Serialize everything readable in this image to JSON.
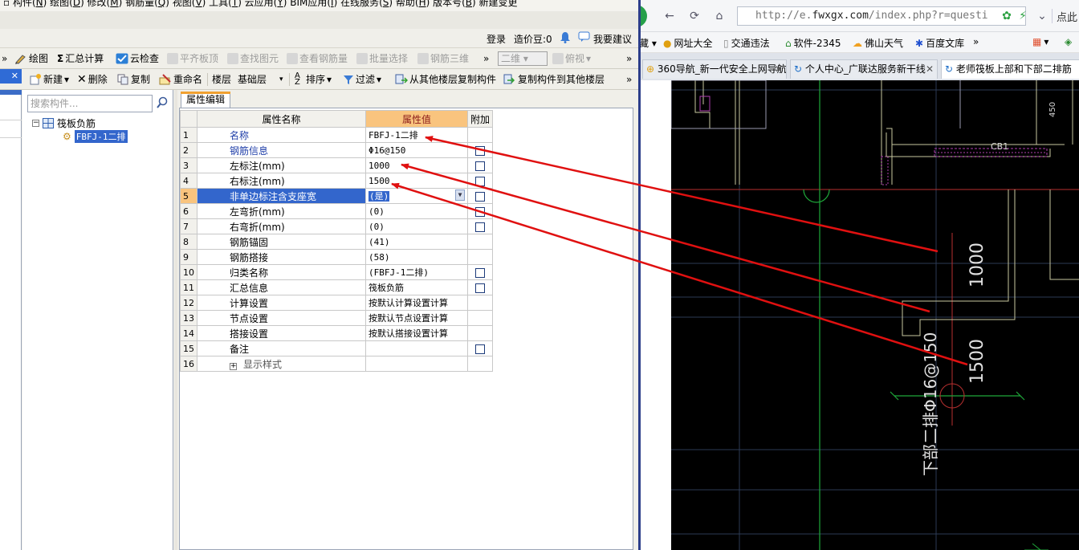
{
  "app": {
    "login": "登录",
    "price_bean": "造价豆:0",
    "suggest": "我要建议"
  },
  "toolbar1": {
    "draw": "绘图",
    "summary": "汇总计算",
    "cloud_check": "云检查",
    "align_top": "平齐板顶",
    "find_element": "查找图元",
    "view_rebar": "查看钢筋量",
    "batch_select": "批量选择",
    "rebar_3d": "钢筋三维",
    "view_mode": "二维",
    "view_dir": "俯视"
  },
  "toolbar2": {
    "new": "新建",
    "delete": "删除",
    "copy": "复制",
    "rename": "重命名",
    "floor_label": "楼层",
    "floor_value": "基础层",
    "sort": "排序",
    "filter": "过滤",
    "copy_from_floor": "从其他楼层复制构件",
    "copy_to_floor": "复制构件到其他楼层"
  },
  "tree": {
    "search_placeholder": "搜索构件...",
    "root": "筏板负筋",
    "child": "FBFJ-1二排"
  },
  "props": {
    "tab": "属性编辑",
    "col_name": "属性名称",
    "col_value": "属性值",
    "col_extra": "附加",
    "rows": [
      {
        "num": "1",
        "name": "名称",
        "value": "FBFJ-1二排",
        "blue": true,
        "cb": false
      },
      {
        "num": "2",
        "name": "钢筋信息",
        "value": "Φ16@150",
        "blue": true,
        "cb": true
      },
      {
        "num": "3",
        "name": "左标注(mm)",
        "value": "1000",
        "blue": false,
        "cb": true
      },
      {
        "num": "4",
        "name": "右标注(mm)",
        "value": "1500",
        "blue": false,
        "cb": true
      },
      {
        "num": "5",
        "name": "非单边标注含支座宽",
        "value": "(是)",
        "blue": false,
        "cb": true,
        "selected": true
      },
      {
        "num": "6",
        "name": "左弯折(mm)",
        "value": "(0)",
        "blue": false,
        "cb": true
      },
      {
        "num": "7",
        "name": "右弯折(mm)",
        "value": "(0)",
        "blue": false,
        "cb": true
      },
      {
        "num": "8",
        "name": "钢筋锚固",
        "value": "(41)",
        "blue": false,
        "cb": false
      },
      {
        "num": "9",
        "name": "钢筋搭接",
        "value": "(58)",
        "blue": false,
        "cb": false
      },
      {
        "num": "10",
        "name": "归类名称",
        "value": "(FBFJ-1二排)",
        "blue": false,
        "cb": true
      },
      {
        "num": "11",
        "name": "汇总信息",
        "value": "筏板负筋",
        "blue": false,
        "cb": true
      },
      {
        "num": "12",
        "name": "计算设置",
        "value": "按默认计算设置计算",
        "blue": false,
        "cb": false
      },
      {
        "num": "13",
        "name": "节点设置",
        "value": "按默认节点设置计算",
        "blue": false,
        "cb": false
      },
      {
        "num": "14",
        "name": "搭接设置",
        "value": "按默认搭接设置计算",
        "blue": false,
        "cb": false
      },
      {
        "num": "15",
        "name": "备注",
        "value": "",
        "blue": false,
        "cb": true
      },
      {
        "num": "16",
        "name": "显示样式",
        "value": "",
        "blue": false,
        "cb": false,
        "expander": true
      }
    ]
  },
  "browser": {
    "url_prefix": "http://e.",
    "url_domain": "fwxgx.com",
    "url_rest": "/index.php?r=questi",
    "url_suffix": "点此",
    "bookmarks": [
      "网址大全",
      "交通违法",
      "软件-2345",
      "佛山天气",
      "百度文库"
    ],
    "tabs": [
      {
        "label": "360导航_新一代安全上网导航",
        "active": false
      },
      {
        "label": "个人中心_广联达服务新干线",
        "active": false
      },
      {
        "label": "老师筏板上部和下部二排筋",
        "active": true
      }
    ]
  },
  "cad": {
    "label_cb1": "CB1",
    "dim_1000": "1000",
    "dim_1500": "1500",
    "rebar_label": "下部二排Φ16@150",
    "small_450": "450"
  },
  "colors": {
    "annotation_arrow": "#e01010",
    "selected_row": "#3366cc",
    "header_value_bg": "#f9c47e"
  }
}
